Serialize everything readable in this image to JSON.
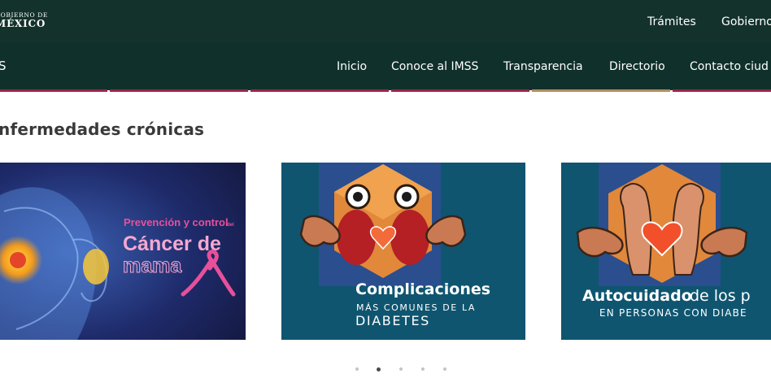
{
  "header": {
    "logo": {
      "line1": "GOBIERNO DE",
      "line2": "MÉXICO"
    },
    "links": [
      "Trámites",
      "Gobierno"
    ]
  },
  "navbar": {
    "brand": "S",
    "items": [
      "Inicio",
      "Conoce al IMSS",
      "Transparencia",
      "Directorio",
      "Contacto ciud"
    ]
  },
  "section": {
    "title": "nfermedades crónicas"
  },
  "cards": [
    {
      "line1": "Prevención y control",
      "line1_small": "del",
      "line2": "Cáncer de",
      "line3": "mama"
    },
    {
      "title": "Complicaciones",
      "line2": "MÁS COMUNES DE LA",
      "line3": "DIABETES"
    },
    {
      "title": "Autocuidado",
      "title_rest": "de los p",
      "line2": "EN PERSONAS CON DIABE"
    }
  ],
  "carousel": {
    "dots": 5,
    "active": 2
  },
  "colors": {
    "header": "#13322b",
    "navbar": "#10312b",
    "stripe": "#9d2449",
    "stripe_gold": "#b38e5d"
  }
}
